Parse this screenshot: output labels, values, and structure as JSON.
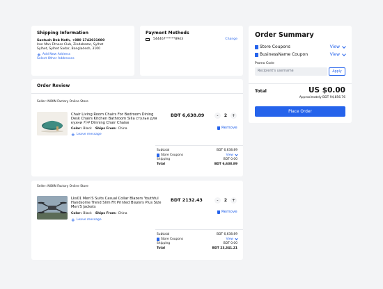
{
  "shipping": {
    "title": "Shipping Information",
    "name_phone": "Santush Deb Nath, +880 1742031080",
    "address_line1": "Iron Man Fitness Club, Zindabazar, Sylhet",
    "address_line2": "Sylhet, Sylhet Sadar, Bangladesh, 3100",
    "add_new": "Add New Address",
    "select_other": "Select Other Addresses"
  },
  "payment": {
    "title": "Payment Methods",
    "card_number": "544467******8943",
    "change": "Change"
  },
  "order_review": {
    "title": "Order Review"
  },
  "stores": [
    {
      "seller": "Seller: NIOIN Factory Online Store",
      "product_title": "Chair Living Room Chairs For Bedroom Dining Desk Chairs Kitchen Bathroom Silla стулья для кухни 가구 Dinning Chair Chaise",
      "color_label": "Color:",
      "color_value": "Black",
      "ships_label": "Ships From:",
      "ships_value": "China",
      "leave_message": "Leave message",
      "price": "BDT 6,638.89",
      "qty": "2",
      "qty_minus": "-",
      "qty_plus": "+",
      "remove": "Remove",
      "summary": {
        "subtotal_label": "Subtotal",
        "subtotal_value": "BDT 6,638.89",
        "coupons_label": "Store Coupons",
        "coupons_value": "View",
        "shipping_label": "Shipping",
        "shipping_value": "BDT 0.00",
        "total_label": "Total",
        "total_value": "BDT 6,638.89"
      }
    },
    {
      "seller": "Seller: NIOIN Factory Online Store",
      "product_title": "Lks01 Men'S Suits Casual Collar Blazers Youthful Handsome Trend Slim Fit Printed Blazers Plus Size Men'S Jackets",
      "color_label": "Color:",
      "color_value": "Black",
      "ships_label": "Ships From:",
      "ships_value": "China",
      "leave_message": "Leave message",
      "price": "BDT 2132.43",
      "qty": "2",
      "qty_minus": "-",
      "qty_plus": "+",
      "remove": "Remove",
      "summary": {
        "subtotal_label": "Subtotal",
        "subtotal_value": "BDT 6,638.89",
        "coupons_label": "Store Coupons",
        "coupons_value": "View",
        "shipping_label": "Shipping",
        "shipping_value": "BDT 0.00",
        "total_label": "Total",
        "total_value": "BDT 23,341.21"
      }
    }
  ],
  "order_summary": {
    "title": "Order Summary",
    "store_coupons": "Store Coupons",
    "business_coupon": "BusinessName Coupon",
    "view": "View",
    "promo_label": "Promo Code",
    "promo_placeholder": "Recipient's username",
    "apply": "Apply",
    "total_label": "Total",
    "total_value": "US $0.00",
    "approx": "Approximately BDT 94,856.76",
    "place_order": "Place Order"
  },
  "colors": {
    "accent": "#2563eb",
    "background": "#f3f4f6"
  }
}
